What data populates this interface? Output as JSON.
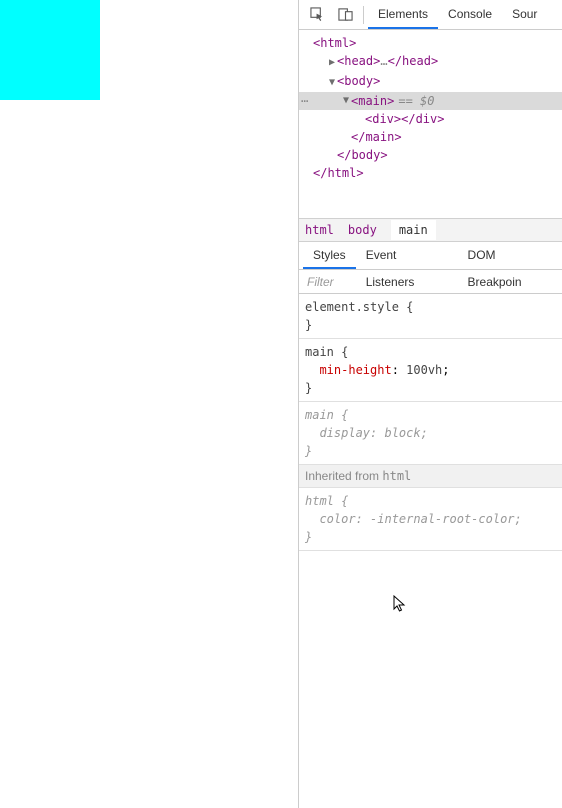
{
  "tabs": {
    "elements": "Elements",
    "console": "Console",
    "sources": "Sour"
  },
  "dom": {
    "html_open": "<html>",
    "head_open": "<head>",
    "head_ellip": "…",
    "head_close": "</head>",
    "body_open": "<body>",
    "main_open": "<main>",
    "eq0": "== $0",
    "div_open": "<div>",
    "div_close": "</div>",
    "main_close": "</main>",
    "body_close": "</body>",
    "html_close": "</html>"
  },
  "breadcrumb": {
    "html": "html",
    "body": "body",
    "main": "main"
  },
  "subtabs": {
    "styles": "Styles",
    "listeners": "Event Listeners",
    "dom_bp": "DOM Breakpoin"
  },
  "filter_placeholder": "Filter",
  "styles": {
    "element_style_sel": "element.style {",
    "brace_close": "}",
    "main_sel": "main {",
    "min_height_prop": "min-height",
    "min_height_val": "100vh",
    "display_prop": "display",
    "display_val": "block",
    "inherited_label": "Inherited from ",
    "inherited_from": "html",
    "html_sel": "html {",
    "color_prop": "color",
    "color_val": "-internal-root-color"
  }
}
